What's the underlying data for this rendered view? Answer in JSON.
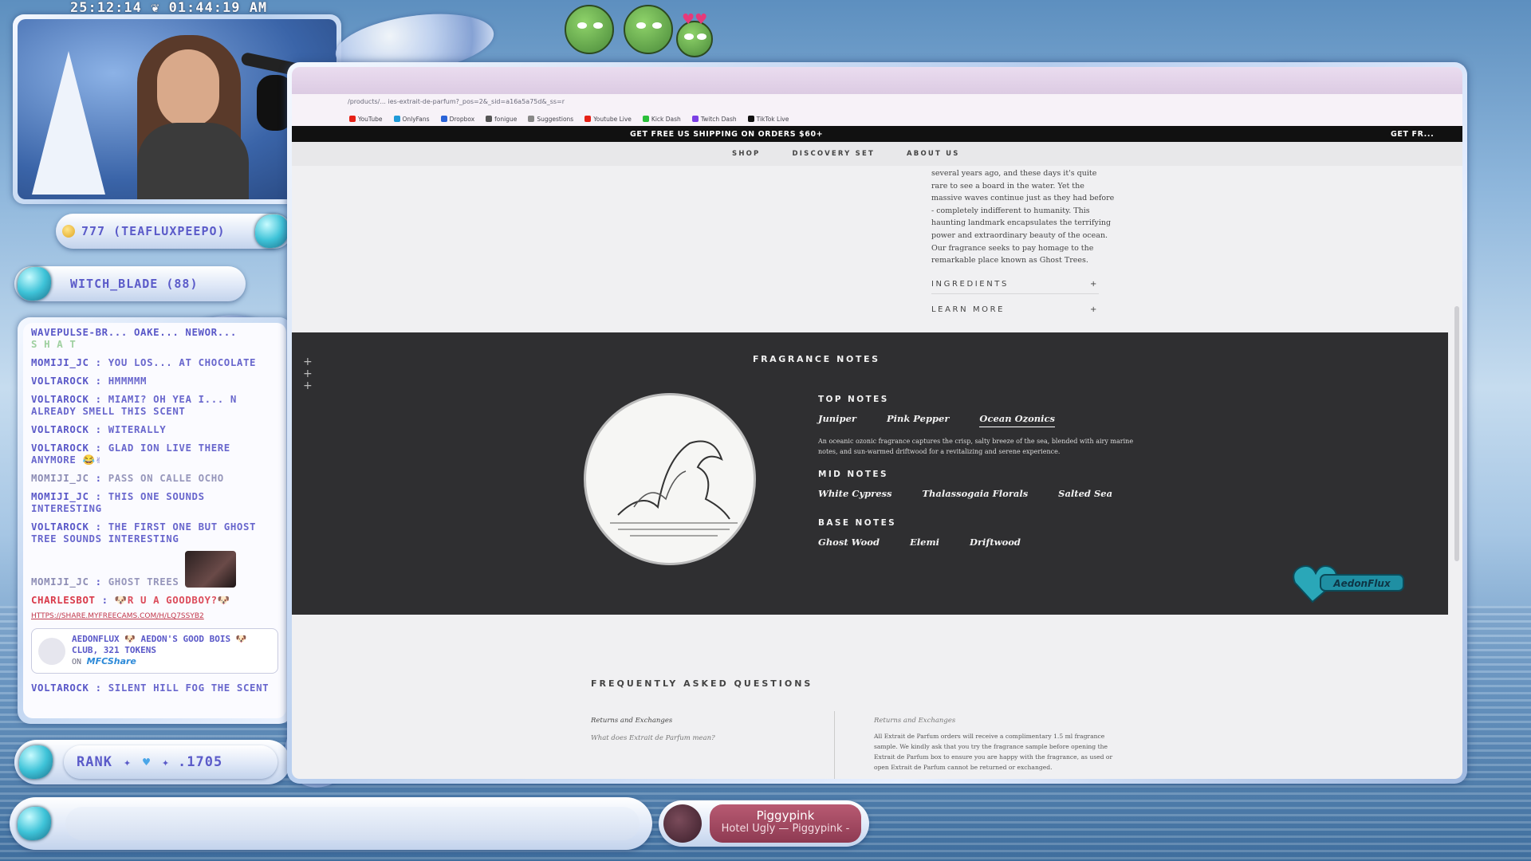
{
  "overlay": {
    "clock": "25:12:14 ❦ 01:44:19 AM",
    "top_supporter": "777 (TEAFLUXPEEPO)",
    "second_supporter": "WITCH_BLADE (88)",
    "rank_label": "RANK",
    "rank_value": ".1705"
  },
  "chat": {
    "header_fragment": "WAVEPULSE-BR... OAKE... NEWOR...",
    "header_sub": "S H A T",
    "messages": [
      {
        "user": "MOMIJI_JC",
        "text": "YOU LOS... AT CHOCOLATE",
        "style": "normal"
      },
      {
        "user": "VOLTAROCK",
        "text": "HMMMMM",
        "style": "normal"
      },
      {
        "user": "VOLTAROCK",
        "text": "MIAMI? OH YEA I... N ALREADY SMELL THIS SCENT",
        "style": "normal"
      },
      {
        "user": "VOLTAROCK",
        "text": "WITERALLY",
        "style": "normal"
      },
      {
        "user": "VOLTAROCK",
        "text": "GLAD ION LIVE THERE ANYMORE 😂✌",
        "style": "normal"
      },
      {
        "user": "MOMIJI_JC",
        "text": "PASS ON CALLE OCHO",
        "style": "alt"
      },
      {
        "user": "MOMIJI_JC",
        "text": "THIS ONE SOUNDS INTERESTING",
        "style": "normal"
      },
      {
        "user": "VOLTAROCK",
        "text": "THE FIRST ONE BUT GHOST TREE SOUNDS INTERESTING",
        "style": "normal"
      },
      {
        "user": "MOMIJI_JC",
        "text": "GHOST TREES",
        "style": "alt"
      },
      {
        "user": "CHARLESBOT",
        "text": "🐶R U A GOODBOY?🐶",
        "style": "red"
      }
    ],
    "link": "HTTPS://SHARE.MYFREECAMS.COM/H/LQ7SSYB2",
    "tip_card": {
      "user": "AEDONFLUX",
      "text": "🐶 AEDON'S GOOD BOIS 🐶 CLUB, 321 TOKENS",
      "on": "ON",
      "brand": "MFCShare"
    },
    "last": {
      "user": "VOLTAROCK",
      "text": "SILENT HILL FOG THE SCENT"
    }
  },
  "music": {
    "title": "Piggypink",
    "subtitle": "Hotel Ugly — Piggypink -"
  },
  "browser": {
    "url": "/products/... ies-extrait-de-parfum?_pos=2&_sid=a16a5a75d&_ss=r",
    "bookmarks": [
      {
        "label": "YouTube",
        "color": "#e62117"
      },
      {
        "label": "OnlyFans",
        "color": "#1f9ad8"
      },
      {
        "label": "Dropbox",
        "color": "#2a63d8"
      },
      {
        "label": "fonigue",
        "color": "#555555"
      },
      {
        "label": "Suggestions",
        "color": "#888888"
      },
      {
        "label": "Youtube Live",
        "color": "#e62117"
      },
      {
        "label": "Kick Dash",
        "color": "#2bbf3a"
      },
      {
        "label": "Twitch Dash",
        "color": "#7b3fe4"
      },
      {
        "label": "TikTok Live",
        "color": "#111111"
      }
    ],
    "promo": "GET FREE US SHIPPING ON ORDERS $60+",
    "promo_repeat": "GET FR...",
    "nav": [
      "SHOP",
      "DISCOVERY SET",
      "ABOUT US"
    ],
    "story": "several years ago, and these days it's quite rare to see a board in the water. Yet the massive waves continue just as they had before - completely indifferent to humanity. This haunting landmark encapsulates the terrifying power and extraordinary beauty of the ocean. Our fragrance seeks to pay homage to the remarkable place known as Ghost Trees.",
    "accordions": [
      {
        "label": "INGREDIENTS",
        "icon": "+"
      },
      {
        "label": "LEARN MORE",
        "icon": "+"
      }
    ],
    "fragrance": {
      "title": "FRAGRANCE NOTES",
      "top_label": "TOP NOTES",
      "top": [
        "Juniper",
        "Pink Pepper",
        "Ocean Ozonics"
      ],
      "description": "An oceanic ozonic fragrance captures the crisp, salty breeze of the sea, blended with airy marine notes, and sun-warmed driftwood for a revitalizing and serene experience.",
      "mid_label": "MID NOTES",
      "mid": [
        "White Cypress",
        "Thalassogaia Florals",
        "Salted Sea"
      ],
      "base_label": "BASE NOTES",
      "base": [
        "Ghost Wood",
        "Elemi",
        "Driftwood"
      ]
    },
    "faq": {
      "title": "FREQUENTLY ASKED QUESTIONS",
      "left_heading": "Returns and Exchanges",
      "left_question": "What does Extrait de Parfum mean?",
      "right_heading": "Returns and Exchanges",
      "right_body": "All Extrait de Parfum orders will receive a complimentary 1.5 ml fragrance sample. We kindly ask that you try the fragrance sample before opening the Extrait de Parfum box to ensure you are happy with the fragrance, as used or open Extrait de Parfum cannot be returned or exchanged."
    },
    "badge": "AedonFlux"
  }
}
